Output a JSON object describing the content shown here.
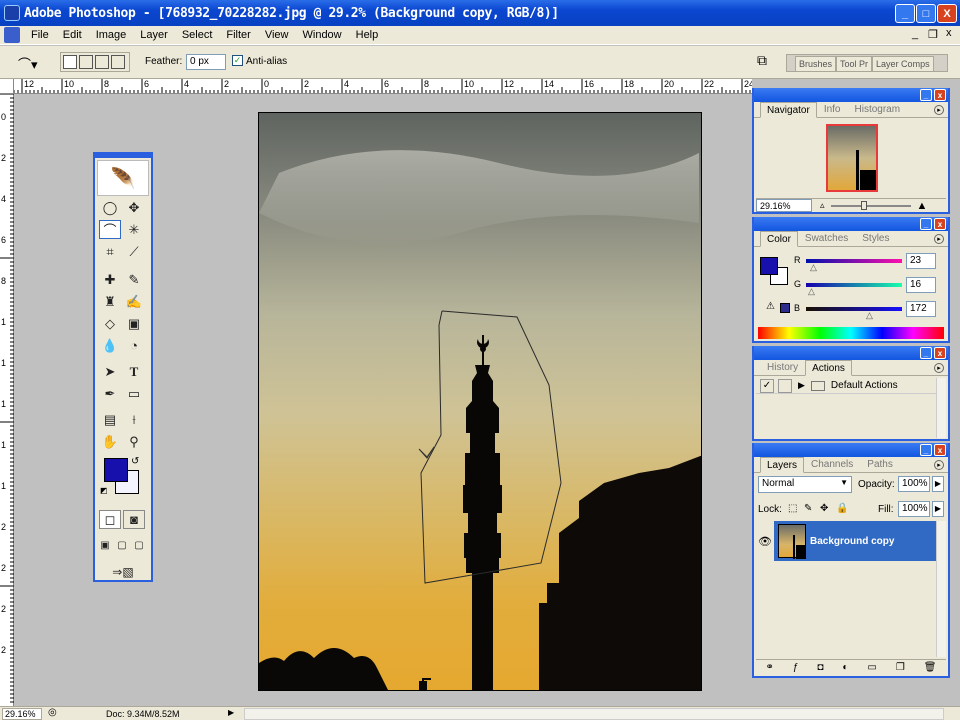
{
  "window": {
    "title": "Adobe Photoshop - [768932_70228282.jpg @ 29.2% (Background copy, RGB/8)]",
    "min_label": "_",
    "max_label": "□",
    "close_label": "X"
  },
  "menu": [
    "File",
    "Edit",
    "Image",
    "Layer",
    "Select",
    "Filter",
    "View",
    "Window",
    "Help"
  ],
  "doc_controls": {
    "min": "_",
    "restore": "❐",
    "close": "x"
  },
  "options": {
    "feather_label": "Feather:",
    "feather_value": "0 px",
    "antialias_label": "Anti-alias",
    "antialias_checked": true
  },
  "well_tabs": [
    "Brushes",
    "Tool Pr",
    "Layer Comps"
  ],
  "ruler_h": [
    "12",
    "10",
    "8",
    "6",
    "4",
    "2",
    "0",
    "2",
    "4",
    "6",
    "8",
    "10",
    "12",
    "14",
    "16",
    "18",
    "20",
    "22",
    "24"
  ],
  "ruler_v": [
    "0",
    "2",
    "4",
    "6",
    "8",
    "1",
    "1",
    "1",
    "1",
    "1",
    "2",
    "2",
    "2",
    "2"
  ],
  "navigator": {
    "tabs": [
      "Navigator",
      "Info",
      "Histogram"
    ],
    "active": 0,
    "zoom": "29.16%"
  },
  "color": {
    "tabs": [
      "Color",
      "Swatches",
      "Styles"
    ],
    "active": 0,
    "r_label": "R",
    "g_label": "G",
    "b_label": "B",
    "r": "23",
    "g": "16",
    "b": "172",
    "fg": "#1710ac"
  },
  "actions": {
    "tabs": [
      "History",
      "Actions"
    ],
    "active": 1,
    "item": "Default Actions"
  },
  "layers": {
    "tabs": [
      "Layers",
      "Channels",
      "Paths"
    ],
    "active": 0,
    "blend": "Normal",
    "opacity_label": "Opacity:",
    "opacity": "100%",
    "lock_label": "Lock:",
    "fill_label": "Fill:",
    "fill": "100%",
    "layer_name": "Background copy"
  },
  "status": {
    "zoom": "29.16%",
    "doc": "Doc: 9.34M/8.52M"
  },
  "colors": {
    "accent": "#2a5fe0",
    "selected": "#316ac5"
  }
}
